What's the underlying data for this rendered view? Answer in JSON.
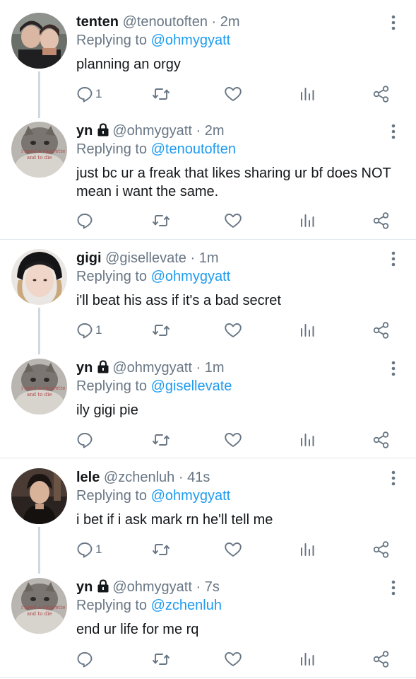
{
  "tweets": [
    {
      "name": "tenten",
      "handle": "@tenoutoften",
      "sep": "·",
      "time": "2m",
      "reply_prefix": "Replying to ",
      "reply_to": "@ohmygyatt",
      "body": "planning an orgy",
      "reply_count": "1",
      "locked": false
    },
    {
      "name": "yn",
      "handle": "@ohmygyatt",
      "sep": "·",
      "time": "2m",
      "reply_prefix": "Replying to ",
      "reply_to": "@tenoutoften",
      "body": "just bc ur a freak that likes sharing ur bf does NOT mean i want the same.",
      "reply_count": "",
      "locked": true
    },
    {
      "name": "gigi",
      "handle": "@gisellevate",
      "sep": "·",
      "time": "1m",
      "reply_prefix": "Replying to ",
      "reply_to": "@ohmygyatt",
      "body": "i'll beat his ass if it's a bad secret",
      "reply_count": "1",
      "locked": false
    },
    {
      "name": "yn",
      "handle": "@ohmygyatt",
      "sep": "·",
      "time": "1m",
      "reply_prefix": "Replying to ",
      "reply_to": "@gisellevate",
      "body": "ily gigi pie",
      "reply_count": "",
      "locked": true
    },
    {
      "name": "lele",
      "handle": "@zchenluh",
      "sep": "·",
      "time": "41s",
      "reply_prefix": "Replying to ",
      "reply_to": "@ohmygyatt",
      "body": "i bet if i ask mark rn he'll tell me",
      "reply_count": "1",
      "locked": false
    },
    {
      "name": "yn",
      "handle": "@ohmygyatt",
      "sep": "·",
      "time": "7s",
      "reply_prefix": "Replying to ",
      "reply_to": "@zchenluh",
      "body": "end ur life for me rq",
      "reply_count": "",
      "locked": true
    }
  ],
  "avatar_text": {
    "line1": "i need a cigarette",
    "line2": "and to die"
  },
  "icons": [
    "reply-icon",
    "retweet-icon",
    "like-icon",
    "analytics-icon",
    "share-icon",
    "more-icon",
    "lock-icon"
  ],
  "colors": {
    "text": "#14171a",
    "muted": "#687684",
    "accent": "#1d9bf0",
    "thread": "#cfd9de",
    "divider": "#e1e8ed"
  }
}
